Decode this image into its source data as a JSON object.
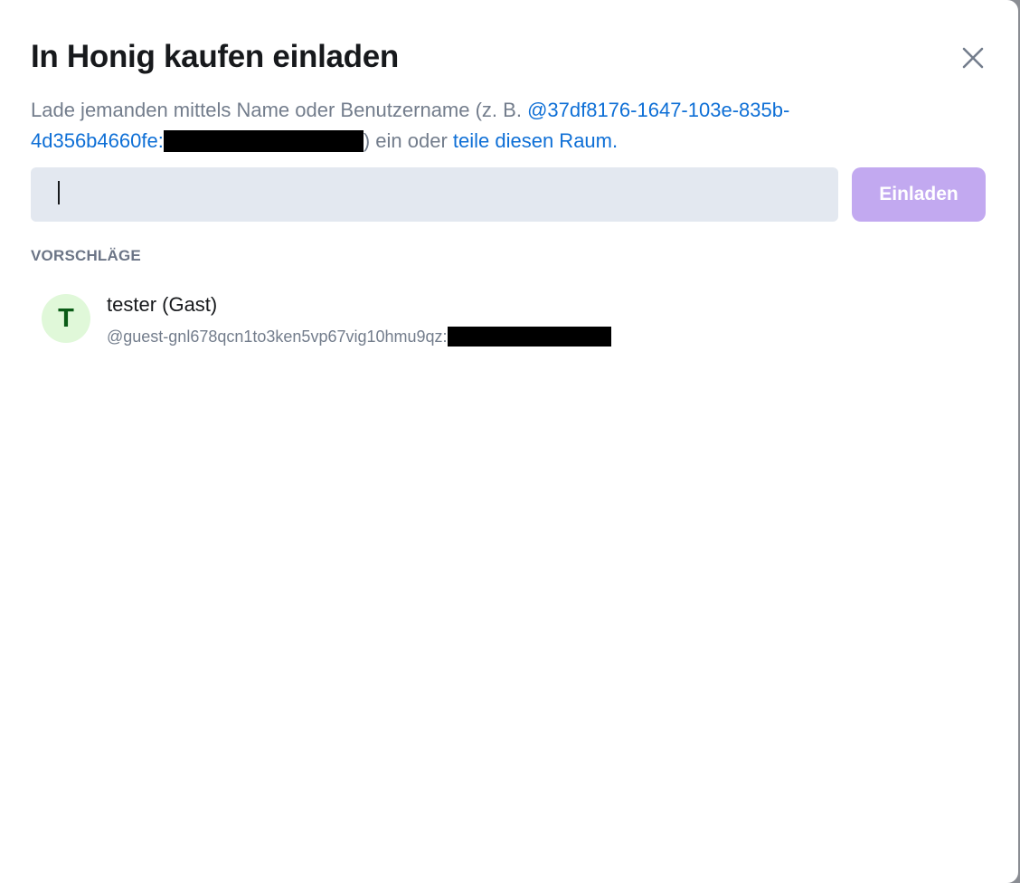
{
  "dialog": {
    "title": "In Honig kaufen einladen",
    "close_icon": "close-icon",
    "description": {
      "prefix": "Lade jemanden mittels Name oder Benutzername (z. B. ",
      "example_user_link": "@37df8176-1647-103e-835b-4d356b4660fe:",
      "middle": ") ein oder ",
      "share_link": "teile diesen Raum."
    },
    "search": {
      "value": "",
      "placeholder": ""
    },
    "invite_button": "Einladen",
    "suggestions_header": "VORSCHLÄGE",
    "suggestions": [
      {
        "avatar_letter": "T",
        "name": "tester (Gast)",
        "user_id": "@guest-gnl678qcn1to3ken5vp67vig10hmu9qz:"
      }
    ]
  },
  "colors": {
    "accent_link": "#0e6fd6",
    "button_disabled": "#c2a9f0",
    "avatar_bg": "#e0f8d9",
    "avatar_fg": "#0a5b16",
    "input_bg": "#e3e8f0"
  }
}
